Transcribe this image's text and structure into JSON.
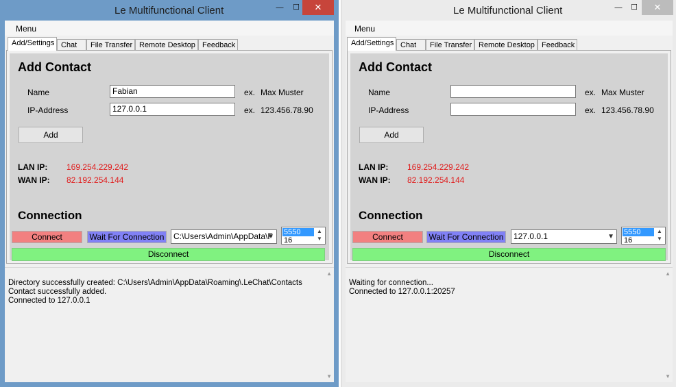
{
  "windows": [
    {
      "title": "Le Multifunctional Client",
      "controls": {
        "minimize": "—",
        "maximize": "☐",
        "close": "✕"
      },
      "menu": "Menu",
      "tabs": [
        "Add/Settings",
        "Chat",
        "File Transfer",
        "Remote Desktop",
        "Feedback"
      ],
      "active_tab": "Add/Settings",
      "add_contact": {
        "heading": "Add Contact",
        "name_label": "Name",
        "name_value": "Fabian",
        "name_example_prefix": "ex.",
        "name_example": "Max Muster",
        "ip_label": "IP-Address",
        "ip_value": "127.0.0.1",
        "ip_example_prefix": "ex.",
        "ip_example": "123.456.78.90",
        "add_button": "Add"
      },
      "lan_ip_label": "LAN IP:",
      "lan_ip": "169.254.229.242",
      "wan_ip_label": "WAN IP:",
      "wan_ip": "82.192.254.144",
      "connection": {
        "heading": "Connection",
        "connect_button": "Connect",
        "wait_button": "Wait For Connection",
        "combo_value": "C:\\Users\\Admin\\AppData\\F",
        "spin_value": "5550",
        "spin_next": "16",
        "disconnect_button": "Disconnect"
      },
      "log": [
        "Directory successfully created: C:\\Users\\Admin\\AppData\\Roaming\\.LeChat\\Contacts",
        "Contact successfully added.",
        "Connected to  127.0.0.1"
      ]
    },
    {
      "title": "Le Multifunctional Client",
      "controls": {
        "minimize": "—",
        "maximize": "☐",
        "close": "✕"
      },
      "menu": "Menu",
      "tabs": [
        "Add/Settings",
        "Chat",
        "File Transfer",
        "Remote Desktop",
        "Feedback"
      ],
      "active_tab": "Add/Settings",
      "add_contact": {
        "heading": "Add Contact",
        "name_label": "Name",
        "name_value": "",
        "name_example_prefix": "ex.",
        "name_example": "Max Muster",
        "ip_label": "IP-Address",
        "ip_value": "",
        "ip_example_prefix": "ex.",
        "ip_example": "123.456.78.90",
        "add_button": "Add"
      },
      "lan_ip_label": "LAN IP:",
      "lan_ip": "169.254.229.242",
      "wan_ip_label": "WAN IP:",
      "wan_ip": "82.192.254.144",
      "connection": {
        "heading": "Connection",
        "connect_button": "Connect",
        "wait_button": "Wait For Connection",
        "combo_value": "127.0.0.1",
        "spin_value": "5550",
        "spin_next": "16",
        "disconnect_button": "Disconnect"
      },
      "log": [
        "Waiting for connection...",
        "Connected to  127.0.0.1:20257"
      ]
    }
  ],
  "colors": {
    "active_frame": "#6e9bc7",
    "close_active": "#c7453b",
    "ip_text": "#e01d1d",
    "connect": "#f28080",
    "wait": "#8181f5",
    "disconnect": "#80f280"
  }
}
